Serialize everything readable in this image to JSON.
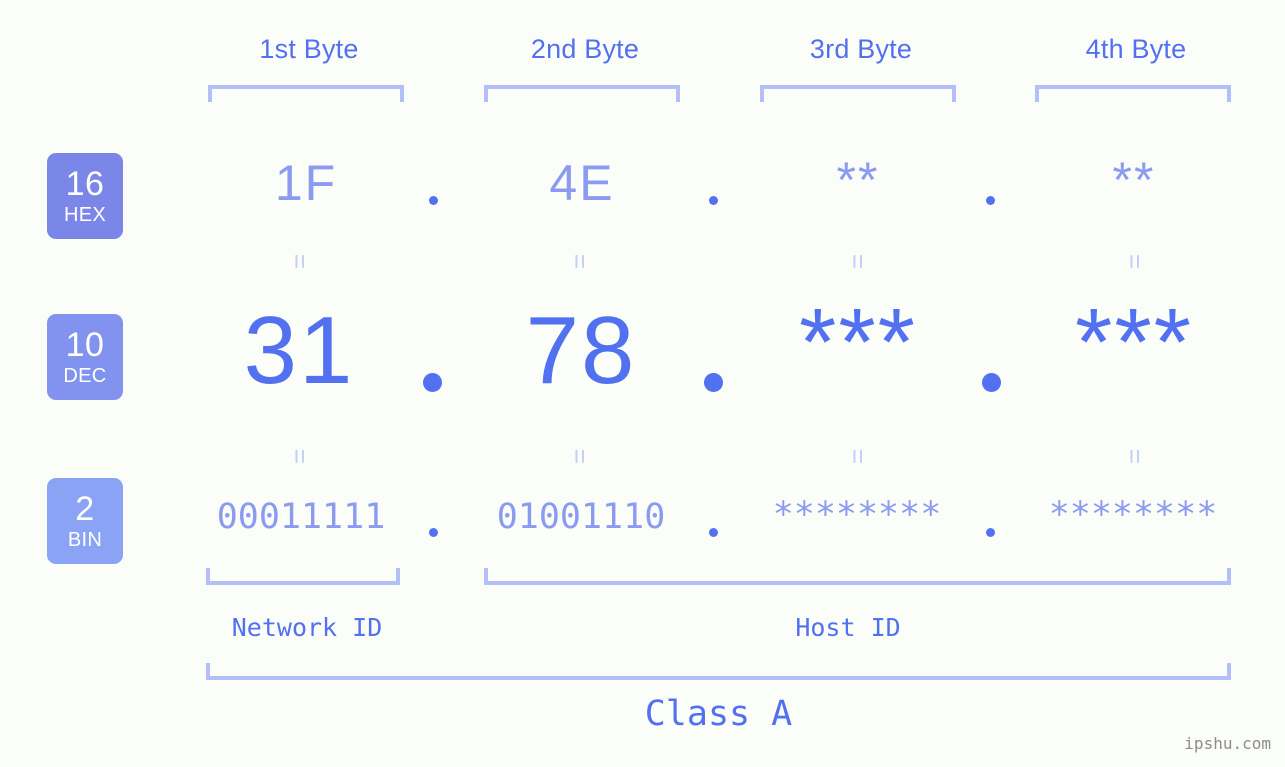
{
  "background_color": "#fbfdf8",
  "accent_color": "#5271f0",
  "muted_accent_color": "#8b9bf0",
  "bracket_color": "#b3c0f7",
  "byte_headers": [
    {
      "label": "1st Byte"
    },
    {
      "label": "2nd Byte"
    },
    {
      "label": "3rd Byte"
    },
    {
      "label": "4th Byte"
    }
  ],
  "rows": [
    {
      "badge": {
        "number": "16",
        "name": "HEX",
        "color": "#7b87e8"
      },
      "values": [
        "1F",
        "4E",
        "**",
        "**"
      ],
      "separator": "."
    },
    {
      "badge": {
        "number": "10",
        "name": "DEC",
        "color": "#8193ef"
      },
      "values": [
        "31",
        "78",
        "***",
        "***"
      ],
      "separator": "."
    },
    {
      "badge": {
        "number": "2",
        "name": "BIN",
        "color": "#8aa3f5"
      },
      "values": [
        "00011111",
        "01001110",
        "********",
        "********"
      ],
      "separator": "."
    }
  ],
  "equality_marks": {
    "symbol": "=",
    "count_per_gap": 4,
    "gaps": 2
  },
  "id_sections": [
    {
      "label": "Network ID"
    },
    {
      "label": "Host ID"
    }
  ],
  "class_section": {
    "label": "Class A"
  },
  "watermark": {
    "text": "ipshu.com"
  }
}
